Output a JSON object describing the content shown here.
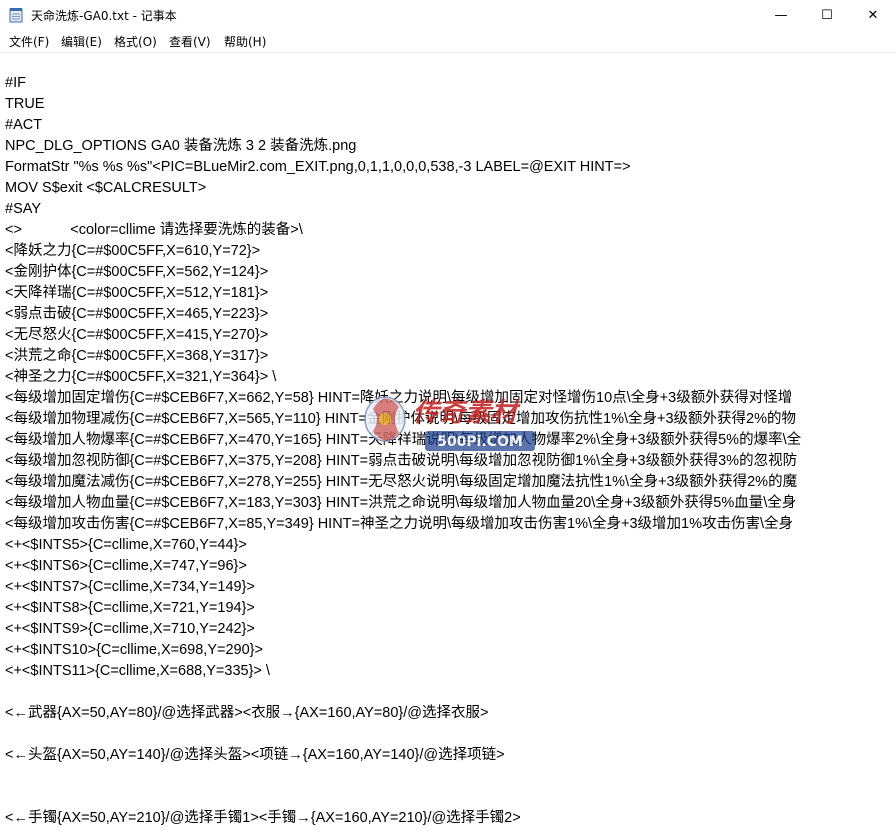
{
  "window": {
    "title": "天命洗炼-GA0.txt - 记事本",
    "minimize_glyph": "—",
    "maximize_glyph": "☐",
    "close_glyph": "✕"
  },
  "menu": [
    "文件(F)",
    "编辑(E)",
    "格式(O)",
    "查看(V)",
    "帮助(H)"
  ],
  "lines": [
    "#IF",
    "TRUE",
    "#ACT",
    "NPC_DLG_OPTIONS GA0 装备洗炼 3 2 装备洗炼.png",
    "FormatStr \"%s %s %s\"<PIC=BLueMir2.com_EXIT.png,0,1,1,0,0,0,538,-3 LABEL=@EXIT HINT=>",
    "MOV S$exit <$CALCRESULT>",
    "#SAY",
    "<>            <color=cllime 请选择要洗炼的装备>\\",
    "<降妖之力{C=#$00C5FF,X=610,Y=72}>",
    "<金刚护体{C=#$00C5FF,X=562,Y=124}>",
    "<天降祥瑞{C=#$00C5FF,X=512,Y=181}>",
    "<弱点击破{C=#$00C5FF,X=465,Y=223}>",
    "<无尽怒火{C=#$00C5FF,X=415,Y=270}>",
    "<洪荒之命{C=#$00C5FF,X=368,Y=317}>",
    "<神圣之力{C=#$00C5FF,X=321,Y=364}> \\",
    "<每级增加固定增伤{C=#$CEB6F7,X=662,Y=58} HINT=降妖之力说明\\每级增加固定对怪增伤10点\\全身+3级额外获得对怪增",
    "<每级增加物理减伤{C=#$CEB6F7,X=565,Y=110} HINT=金刚护体说明\\每级固定增加攻伤抗性1%\\全身+3级额外获得2%的物",
    "<每级增加人物爆率{C=#$CEB6F7,X=470,Y=165} HINT=天降祥瑞说明\\每级增加人物爆率2%\\全身+3级额外获得5%的爆率\\全",
    "<每级增加忽视防御{C=#$CEB6F7,X=375,Y=208} HINT=弱点击破说明\\每级增加忽视防御1%\\全身+3级额外获得3%的忽视防",
    "<每级增加魔法减伤{C=#$CEB6F7,X=278,Y=255} HINT=无尽怒火说明\\每级固定增加魔法抗性1%\\全身+3级额外获得2%的魔",
    "<每级增加人物血量{C=#$CEB6F7,X=183,Y=303} HINT=洪荒之命说明\\每级增加人物血量20\\全身+3级额外获得5%血量\\全身",
    "<每级增加攻击伤害{C=#$CEB6F7,X=85,Y=349} HINT=神圣之力说明\\每级增加攻击伤害1%\\全身+3级增加1%攻击伤害\\全身",
    "<+<$INTS5>{C=cllime,X=760,Y=44}>",
    "<+<$INTS6>{C=cllime,X=747,Y=96}>",
    "<+<$INTS7>{C=cllime,X=734,Y=149}>",
    "<+<$INTS8>{C=cllime,X=721,Y=194}>",
    "<+<$INTS9>{C=cllime,X=710,Y=242}>",
    "<+<$INTS10>{C=cllime,X=698,Y=290}>",
    "<+<$INTS11>{C=cllime,X=688,Y=335}> \\",
    "",
    "<←武器{AX=50,AY=80}/@选择武器><衣服→{AX=160,AY=80}/@选择衣服>",
    "",
    "<←头盔{AX=50,AY=140}/@选择头盔><项链→{AX=160,AY=140}/@选择项链>",
    "",
    "",
    "<←手镯{AX=50,AY=210}/@选择手镯1><手镯→{AX=160,AY=210}/@选择手镯2>"
  ],
  "watermark": {
    "brand": "传奇素材",
    "site": "500Pi.COM"
  }
}
